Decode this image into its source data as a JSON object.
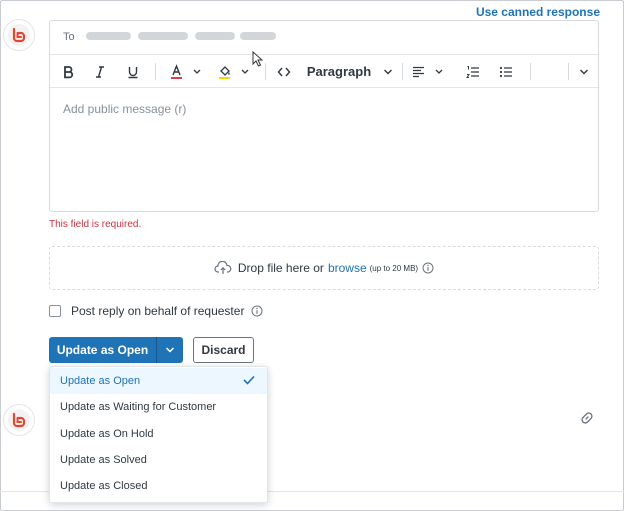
{
  "header": {
    "canned_response": "Use canned response"
  },
  "editor": {
    "to_label": "To",
    "placeholder": "Add public message (r)",
    "format_label": "Paragraph"
  },
  "validation": {
    "error": "This field is required."
  },
  "dropzone": {
    "text": "Drop file here or",
    "link": "browse",
    "limit": "(up to 20 MB)"
  },
  "options": {
    "post_on_behalf": "Post reply on behalf of requester"
  },
  "actions": {
    "submit_label": "Update as Open",
    "discard_label": "Discard"
  },
  "menu": {
    "items": [
      {
        "label": "Update as Open"
      },
      {
        "label": "Update as Waiting for Customer"
      },
      {
        "label": "Update as On Hold"
      },
      {
        "label": "Update as Solved"
      },
      {
        "label": "Update as Closed"
      }
    ],
    "selected_index": 0
  },
  "colors": {
    "accent": "#1f73b7",
    "error": "#cc3340",
    "logo": "#e5462f",
    "text_color_indicator": "#d93f4c",
    "highlight_indicator": "#f5d800"
  },
  "icons": {
    "bold": "bold-icon",
    "italic": "italic-icon",
    "underline": "underline-icon",
    "text_color": "text-color-icon",
    "highlight": "highlight-icon",
    "code": "code-icon",
    "align": "align-icon",
    "ordered_list": "ordered-list-icon",
    "bullet_list": "bullet-list-icon",
    "upload": "cloud-upload-icon",
    "info": "info-icon",
    "link": "link-icon",
    "check": "check-icon"
  }
}
